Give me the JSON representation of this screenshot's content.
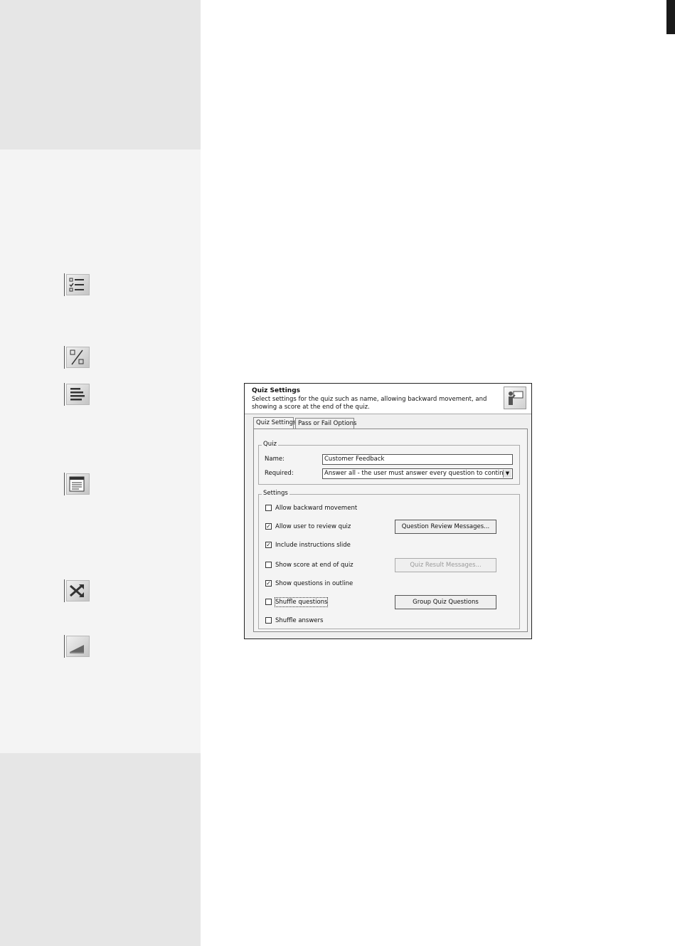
{
  "dialog": {
    "title": "Quiz Settings",
    "description": "Select settings for the quiz such as name, allowing backward movement, and showing a score at the end of the quiz.",
    "tabs": [
      {
        "label": "Quiz Settings",
        "active": true
      },
      {
        "label": "Pass or Fail Options",
        "active": false
      }
    ],
    "quiz_group": {
      "label": "Quiz",
      "name_label": "Name:",
      "name_value": "Customer Feedback",
      "required_label": "Required:",
      "required_value": "Answer all - the user must answer every question to continue"
    },
    "settings_group": {
      "label": "Settings",
      "options": [
        {
          "label": "Allow backward movement",
          "checked": false
        },
        {
          "label": "Allow user to review quiz",
          "checked": true
        },
        {
          "label": "Include instructions slide",
          "checked": true
        },
        {
          "label": "Show score at end of quiz",
          "checked": false
        },
        {
          "label": "Show questions in outline",
          "checked": true
        },
        {
          "label": "Shuffle questions",
          "checked": false
        },
        {
          "label": "Shuffle answers",
          "checked": false
        }
      ],
      "buttons": {
        "review_messages": "Question Review Messages...",
        "result_messages": "Quiz Result Messages...",
        "group_questions": "Group Quiz Questions"
      }
    }
  },
  "sidebar_icons": [
    {
      "icon": "checklist-icon"
    },
    {
      "icon": "percent-icon"
    },
    {
      "icon": "align-left-icon"
    },
    {
      "icon": "text-box-icon"
    },
    {
      "icon": "shuffle-icon"
    },
    {
      "icon": "progress-icon"
    }
  ]
}
